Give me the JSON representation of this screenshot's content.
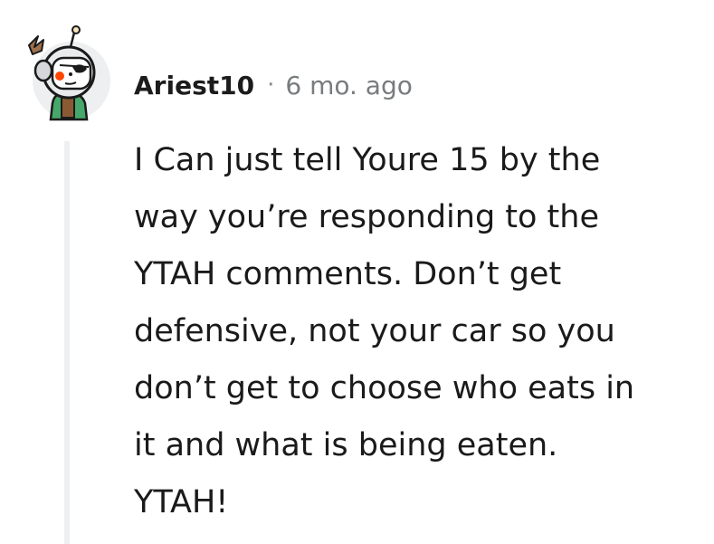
{
  "comment": {
    "avatar_icon": "astronaut-avatar-icon",
    "author": "Ariest10",
    "separator": "·",
    "timestamp": "6 mo. ago",
    "body_lines": [
      "I Can just tell Youre 15 by the",
      "way you’re responding to the",
      "YTAH comments. Don’t get",
      "defensive, not your car so you",
      "don’t get to choose who eats in",
      "it and what is being eaten.",
      "YTAH!"
    ]
  },
  "colors": {
    "author_text": "#1c1c1c",
    "timestamp_text": "#787c7e",
    "body_text": "#1a1a1b",
    "thread_line": "#edeff1",
    "avatar_background": "#edeff1"
  }
}
